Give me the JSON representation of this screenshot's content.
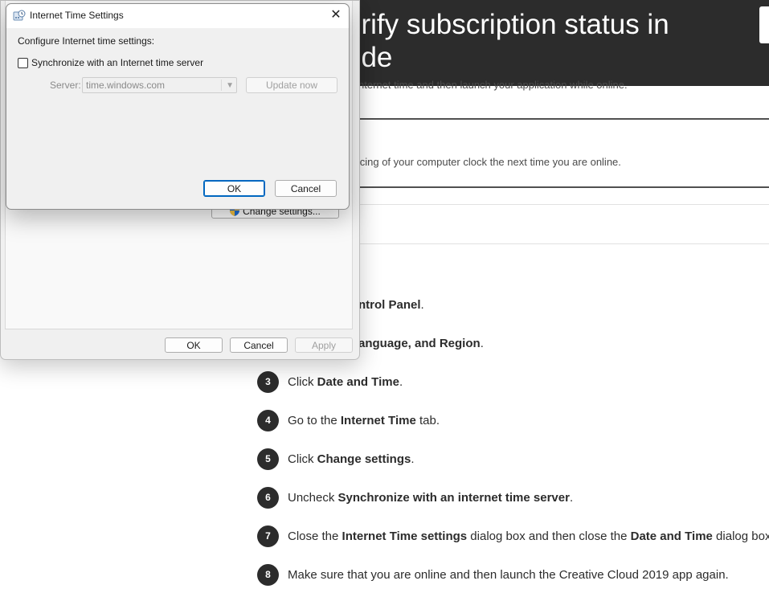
{
  "page": {
    "title": "erify subscription status in\node",
    "para1": "nternet time and then launch your application while online.",
    "para2": "yncing of your computer clock the next time you are online.",
    "steps": [
      {
        "num": "3",
        "pre": "Click ",
        "bold1": "Date and Time",
        "mid": ".",
        "bold2": "",
        "post": ""
      },
      {
        "num": "4",
        "pre": "Go to the ",
        "bold1": "Internet Time",
        "mid": " tab.",
        "bold2": "",
        "post": ""
      },
      {
        "num": "5",
        "pre": "Click ",
        "bold1": "Change settings",
        "mid": ".",
        "bold2": "",
        "post": ""
      },
      {
        "num": "6",
        "pre": "Uncheck ",
        "bold1": "Synchronize with an internet time server",
        "mid": ".",
        "bold2": "",
        "post": ""
      },
      {
        "num": "7",
        "pre": "Close the ",
        "bold1": "Internet Time settings",
        "mid": " dialog box and then close the ",
        "bold2": "Date and Time",
        "post": " dialog box."
      },
      {
        "num": "8",
        "pre": "Make sure that you are online and then launch the Creative Cloud 2019 app again.",
        "bold1": "",
        "mid": "",
        "bold2": "",
        "post": ""
      }
    ],
    "frag1_bold": "ntrol Panel",
    "frag1_post": ".",
    "frag2_bold": "anguage, and Region",
    "frag2_post": "."
  },
  "date_time_dialog": {
    "change_settings_label": "Change settings...",
    "ok_label": "OK",
    "cancel_label": "Cancel",
    "apply_label": "Apply"
  },
  "internet_time_dialog": {
    "title": "Internet Time Settings",
    "configure_label": "Configure Internet time settings:",
    "sync_label": "Synchronize with an Internet time server",
    "sync_checked": false,
    "server_label": "Server:",
    "server_value": "time.windows.com",
    "update_label": "Update now",
    "ok_label": "OK",
    "cancel_label": "Cancel"
  },
  "colors": {
    "hero_bg": "#2c2c2c",
    "step_badge": "#2c2c2c",
    "focus_blue": "#0067c0"
  }
}
